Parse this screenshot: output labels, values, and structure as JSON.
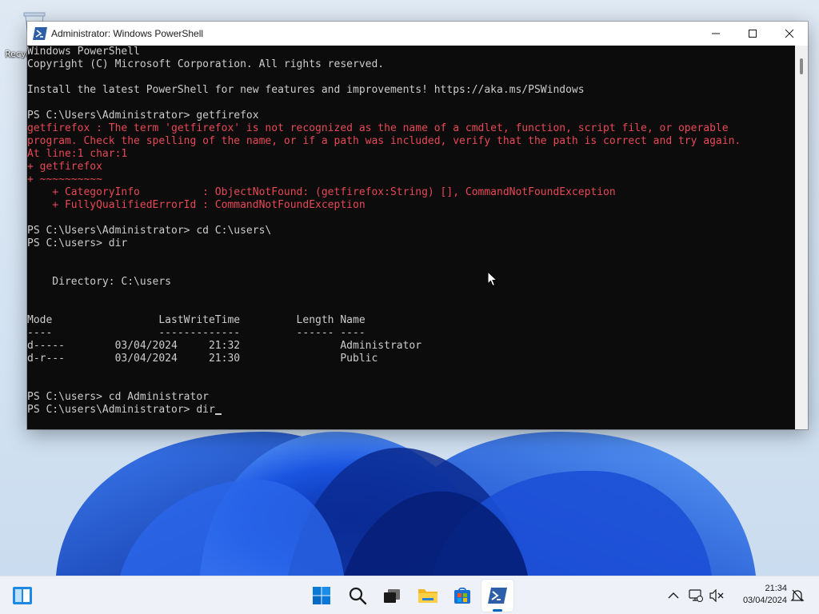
{
  "desktop": {
    "recycle_bin_label": "Recycle Bin"
  },
  "window": {
    "title": "Administrator: Windows PowerShell",
    "controls": {
      "minimize": "minimize-icon",
      "maximize": "maximize-icon",
      "close": "close-icon"
    }
  },
  "console": {
    "text_color": "#cccccc",
    "error_color": "#e74856",
    "background": "#0c0c0c",
    "lines": [
      {
        "text": "Windows PowerShell",
        "style": "normal"
      },
      {
        "text": "Copyright (C) Microsoft Corporation. All rights reserved.",
        "style": "normal"
      },
      {
        "text": "",
        "style": "normal"
      },
      {
        "text": "Install the latest PowerShell for new features and improvements! https://aka.ms/PSWindows",
        "style": "normal"
      },
      {
        "text": "",
        "style": "normal"
      },
      {
        "text": "PS C:\\Users\\Administrator> getfirefox",
        "style": "normal"
      },
      {
        "text": "getfirefox : The term 'getfirefox' is not recognized as the name of a cmdlet, function, script file, or operable",
        "style": "error"
      },
      {
        "text": "program. Check the spelling of the name, or if a path was included, verify that the path is correct and try again.",
        "style": "error"
      },
      {
        "text": "At line:1 char:1",
        "style": "error"
      },
      {
        "text": "+ getfirefox",
        "style": "error"
      },
      {
        "text": "+ ~~~~~~~~~~",
        "style": "error"
      },
      {
        "text": "    + CategoryInfo          : ObjectNotFound: (getfirefox:String) [], CommandNotFoundException",
        "style": "error"
      },
      {
        "text": "    + FullyQualifiedErrorId : CommandNotFoundException",
        "style": "error"
      },
      {
        "text": "",
        "style": "normal"
      },
      {
        "text": "PS C:\\Users\\Administrator> cd C:\\users\\",
        "style": "normal"
      },
      {
        "text": "PS C:\\users> dir",
        "style": "normal"
      },
      {
        "text": "",
        "style": "normal"
      },
      {
        "text": "",
        "style": "normal"
      },
      {
        "text": "    Directory: C:\\users",
        "style": "normal"
      },
      {
        "text": "",
        "style": "normal"
      },
      {
        "text": "",
        "style": "normal"
      },
      {
        "text": "Mode                 LastWriteTime         Length Name",
        "style": "normal"
      },
      {
        "text": "----                 -------------         ------ ----",
        "style": "normal"
      },
      {
        "text": "d-----        03/04/2024     21:32                Administrator",
        "style": "normal"
      },
      {
        "text": "d-r---        03/04/2024     21:30                Public",
        "style": "normal"
      },
      {
        "text": "",
        "style": "normal"
      },
      {
        "text": "",
        "style": "normal"
      },
      {
        "text": "PS C:\\users> cd Administrator",
        "style": "normal"
      }
    ],
    "current_prompt": "PS C:\\users\\Administrator> ",
    "current_input": "dir"
  },
  "taskbar": {
    "items": [
      {
        "name": "widgets",
        "icon": "widgets-icon"
      },
      {
        "name": "start",
        "icon": "windows-logo-icon"
      },
      {
        "name": "search",
        "icon": "search-icon"
      },
      {
        "name": "task-view",
        "icon": "task-view-icon"
      },
      {
        "name": "file-explorer",
        "icon": "folder-icon"
      },
      {
        "name": "microsoft-store",
        "icon": "store-icon"
      },
      {
        "name": "powershell",
        "icon": "powershell-icon",
        "active": true
      }
    ],
    "tray": {
      "time": "21:34",
      "date": "03/04/2024",
      "icons": [
        "chevron-up-icon",
        "network-icon",
        "volume-muted-icon",
        "notification-icon"
      ]
    }
  },
  "colors": {
    "accent": "#0067c0",
    "powershell_blue": "#2c5fa8",
    "taskbar": "#eef2f8"
  }
}
